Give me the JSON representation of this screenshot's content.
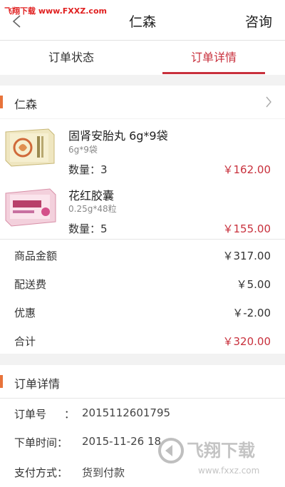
{
  "watermark_top": "飞翔下载 www.FXXZ.com",
  "header": {
    "title": "仁森",
    "consult_label": "咨询"
  },
  "tabs": [
    {
      "label": "订单状态",
      "active": false
    },
    {
      "label": "订单详情",
      "active": true
    }
  ],
  "store": {
    "name": "仁森"
  },
  "products": [
    {
      "name": "固肾安胎丸 6g*9袋",
      "spec": "6g*9袋",
      "qty_label": "数量：3",
      "price": "￥162.00"
    },
    {
      "name": "花红胶囊",
      "spec": "0.25g*48粒",
      "qty_label": "数量：5",
      "price": "￥155.00"
    }
  ],
  "summary": {
    "goods_label": "商品金额",
    "goods_value": "￥317.00",
    "delivery_label": "配送费",
    "delivery_value": "￥5.00",
    "discount_label": "优惠",
    "discount_value": "￥-2.00",
    "total_label": "合计",
    "total_value": "￥320.00"
  },
  "details": {
    "section_title": "订单详情",
    "order_no_label": "订单号",
    "order_no_value": "2015112601795",
    "order_time_label": "下单时间：",
    "order_time_value": "2015-11-26 18",
    "pay_label": "支付方式：",
    "pay_value": "货到付款",
    "colon": "："
  },
  "watermark_bottom": {
    "text": "飞翔下载",
    "url": "www.fxxz.com"
  },
  "colors": {
    "accent": "#c8303c",
    "marker": "#e8733a"
  }
}
